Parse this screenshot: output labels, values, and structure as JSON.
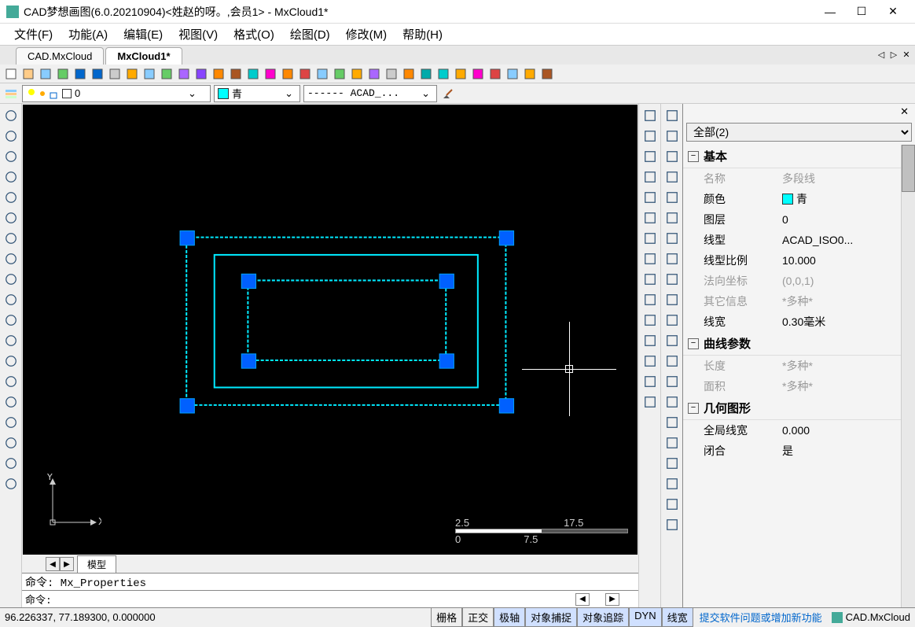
{
  "window": {
    "title": "CAD梦想画图(6.0.20210904)<姓赵的呀。,会员1> - MxCloud1*"
  },
  "menubar": [
    {
      "label": "文件(F)"
    },
    {
      "label": "功能(A)"
    },
    {
      "label": "编辑(E)"
    },
    {
      "label": "视图(V)"
    },
    {
      "label": "格式(O)"
    },
    {
      "label": "绘图(D)"
    },
    {
      "label": "修改(M)"
    },
    {
      "label": "帮助(H)"
    }
  ],
  "tabs": [
    {
      "label": "CAD.MxCloud",
      "active": false
    },
    {
      "label": "MxCloud1*",
      "active": true
    }
  ],
  "layer": {
    "current": "0",
    "color_label": "青",
    "linetype": "------ ACAD_..."
  },
  "properties": {
    "selection": "全部(2)",
    "sections": [
      {
        "name": "基本",
        "rows": [
          {
            "k": "名称",
            "v": "多段线",
            "disabled": true
          },
          {
            "k": "颜色",
            "v": "青",
            "swatch": "#00ffff"
          },
          {
            "k": "图层",
            "v": "0"
          },
          {
            "k": "线型",
            "v": "ACAD_ISO0..."
          },
          {
            "k": "线型比例",
            "v": "10.000"
          },
          {
            "k": "法向坐标",
            "v": "(0,0,1)",
            "disabled": true
          },
          {
            "k": "其它信息",
            "v": "*多种*",
            "disabled": true
          },
          {
            "k": "线宽",
            "v": "0.30毫米"
          }
        ]
      },
      {
        "name": "曲线参数",
        "rows": [
          {
            "k": "长度",
            "v": "*多种*",
            "disabled": true
          },
          {
            "k": "面积",
            "v": "*多种*",
            "disabled": true
          }
        ]
      },
      {
        "name": "几何图形",
        "rows": [
          {
            "k": "全局线宽",
            "v": "0.000"
          },
          {
            "k": "闭合",
            "v": "是"
          }
        ]
      }
    ]
  },
  "command": {
    "history": "命令: Mx_Properties",
    "prompt": "命令:"
  },
  "bottom_tab": "模型",
  "status": {
    "coords": "96.226337, 77.189300, 0.000000",
    "modes": [
      {
        "label": "栅格",
        "active": false
      },
      {
        "label": "正交",
        "active": false
      },
      {
        "label": "极轴",
        "active": true
      },
      {
        "label": "对象捕捉",
        "active": true
      },
      {
        "label": "对象追踪",
        "active": true
      },
      {
        "label": "DYN",
        "active": true
      },
      {
        "label": "线宽",
        "active": true
      }
    ],
    "link": "提交软件问题或增加新功能",
    "brand": "CAD.MxCloud"
  },
  "scale": {
    "a": "2.5",
    "b": "17.5",
    "c": "0",
    "d": "7.5"
  }
}
